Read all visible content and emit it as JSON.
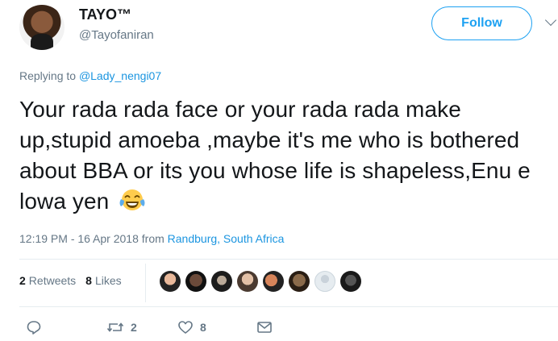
{
  "author": {
    "display_name": "TAYO™",
    "handle": "@Tayofaniran",
    "avatar_icon": "avatar"
  },
  "follow_label": "Follow",
  "reply": {
    "prefix": "Replying to",
    "mention": "@Lady_nengi07"
  },
  "tweet": {
    "text": "Your rada rada face or your rada rada make up,stupid amoeba ,maybe it's me who is bothered about BBA or its you whose life is shapeless,Enu e lowa yen",
    "emoji": "face-with-tears-of-joy"
  },
  "meta": {
    "timestamp": "12:19 PM - 16 Apr 2018",
    "from_label": "from",
    "location": "Randburg, South Africa"
  },
  "stats": {
    "retweets_count": "2",
    "retweets_label": "Retweets",
    "likes_count": "8",
    "likes_label": "Likes"
  },
  "actions": {
    "reply_count": "",
    "retweet_count": "2",
    "like_count": "8"
  },
  "colors": {
    "accent": "#1da1f2",
    "link": "#1b95e0",
    "muted": "#657786",
    "text": "#14171a"
  }
}
